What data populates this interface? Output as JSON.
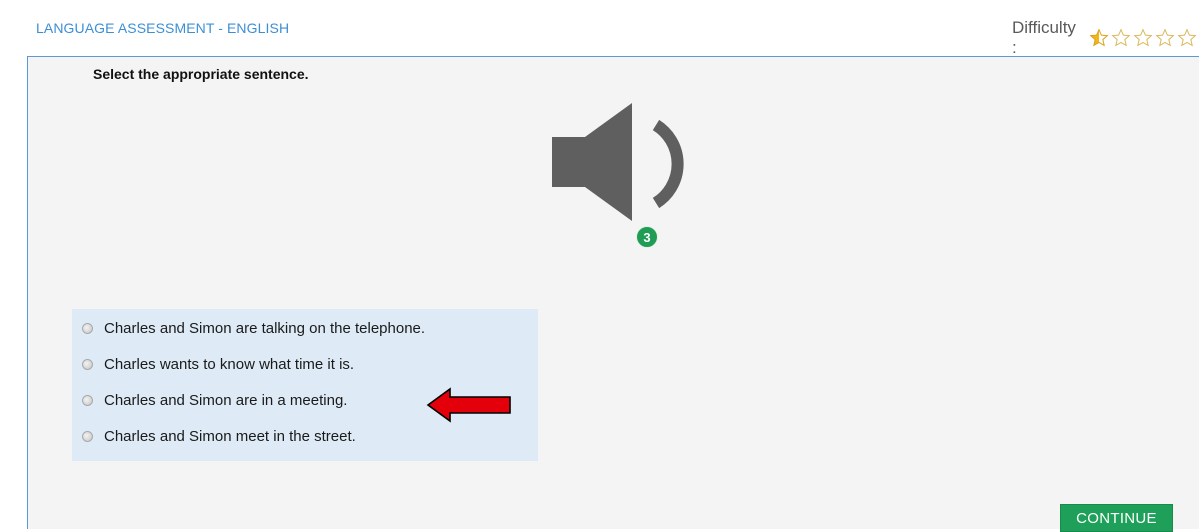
{
  "header": {
    "title": "LANGUAGE ASSESSMENT - ENGLISH",
    "difficulty_label": "Difficulty :",
    "difficulty_rating": 1,
    "difficulty_max": 5
  },
  "question": {
    "instruction": "Select the appropriate sentence.",
    "audio_icon": "speaker-icon",
    "plays_remaining": "3",
    "options": [
      "Charles and Simon are talking on the telephone.",
      "Charles wants to know what time it is.",
      "Charles and Simon are in a meeting.",
      "Charles and Simon meet in the street."
    ],
    "pointed_option_index": 2
  },
  "actions": {
    "continue_label": "CONTINUE"
  },
  "colors": {
    "title": "#3c8fd6",
    "panel_border": "#5b9bd5",
    "options_bg": "#deebf7",
    "badge": "#1f9d55",
    "button": "#1fa05a",
    "arrow": "#e3000b",
    "speaker": "#5f5f5f"
  }
}
